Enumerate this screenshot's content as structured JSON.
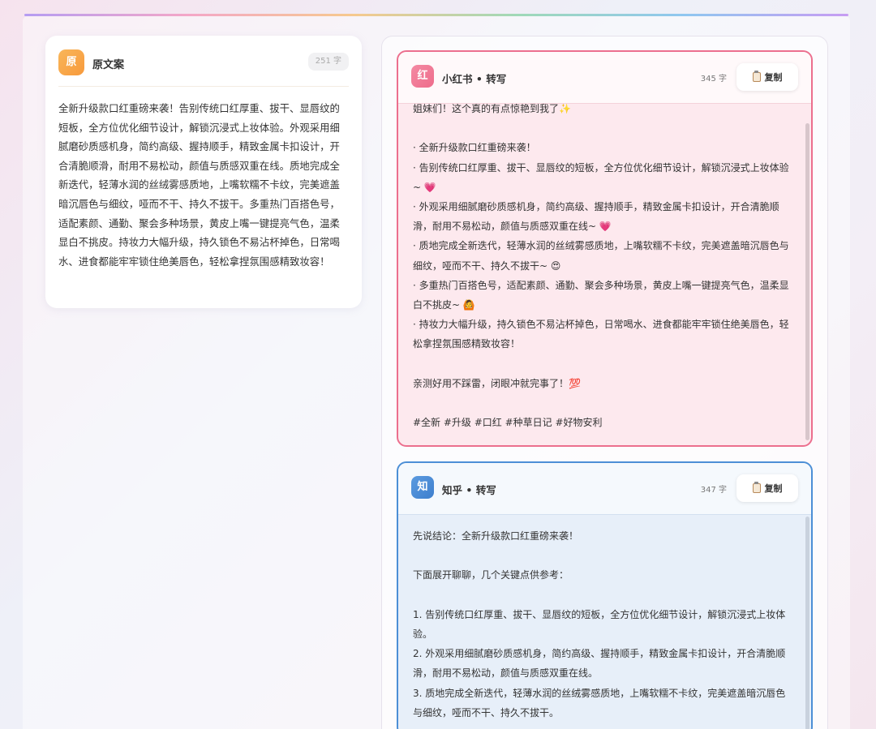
{
  "original": {
    "avatar": "原",
    "title": "原文案",
    "count": "251 字",
    "text": "全新升级款口红重磅来袭！告别传统口红厚重、拔干、显唇纹的短板，全方位优化细节设计，解锁沉浸式上妆体验。外观采用细腻磨砂质感机身，简约高级、握持顺手，精致金属卡扣设计，开合清脆顺滑，耐用不易松动，颜值与质感双重在线。质地完成全新迭代，轻薄水润的丝绒雾感质地，上嘴软糯不卡纹，完美遮盖暗沉唇色与细纹，哑而不干、持久不拔干。多重热门百搭色号，适配素颜、通勤、聚会多种场景，黄皮上嘴一键提亮气色，温柔显白不挑皮。持妆力大幅升级，持久锁色不易沾杯掉色，日常喝水、进食都能牢牢锁住绝美唇色，轻松拿捏氛围感精致妆容！"
  },
  "xiaohongshu": {
    "avatar": "红",
    "title": "小红书 • 转写",
    "count": "345 字",
    "copy_label": "复制",
    "text": "姐妹们！这个真的有点惊艳到我了✨\n\n· 全新升级款口红重磅来袭！\n· 告别传统口红厚重、拔干、显唇纹的短板，全方位优化细节设计，解锁沉浸式上妆体验~ 💗\n· 外观采用细腻磨砂质感机身，简约高级、握持顺手，精致金属卡扣设计，开合清脆顺滑，耐用不易松动，颜值与质感双重在线~ 💗\n· 质地完成全新迭代，轻薄水润的丝绒雾感质地，上嘴软糯不卡纹，完美遮盖暗沉唇色与细纹，哑而不干、持久不拔干~ 😍\n· 多重热门百搭色号，适配素颜、通勤、聚会多种场景，黄皮上嘴一键提亮气色，温柔显白不挑皮~ 🙆\n· 持妆力大幅升级，持久锁色不易沾杯掉色，日常喝水、进食都能牢牢锁住绝美唇色，轻松拿捏氛围感精致妆容！\n\n亲测好用不踩雷，闭眼冲就完事了！💯\n\n#全新 #升级 #口红 #种草日记 #好物安利"
  },
  "zhihu": {
    "avatar": "知",
    "title": "知乎 • 转写",
    "count": "347 字",
    "copy_label": "复制",
    "text": "先说结论：全新升级款口红重磅来袭！\n\n下面展开聊聊，几个关键点供参考：\n\n1. 告别传统口红厚重、拔干、显唇纹的短板，全方位优化细节设计，解锁沉浸式上妆体验。\n2. 外观采用细腻磨砂质感机身，简约高级、握持顺手，精致金属卡扣设计，开合清脆顺滑，耐用不易松动，颜值与质感双重在线。\n3. 质地完成全新迭代，轻薄水润的丝绒雾感质地，上嘴软糯不卡纹，完美遮盖暗沉唇色与细纹，哑而不干、持久不拔干。"
  },
  "colors": {
    "xhs_accent": "#ec6f8e",
    "zhihu_accent": "#4c8fd6",
    "original_accent": "#f79a3c"
  }
}
